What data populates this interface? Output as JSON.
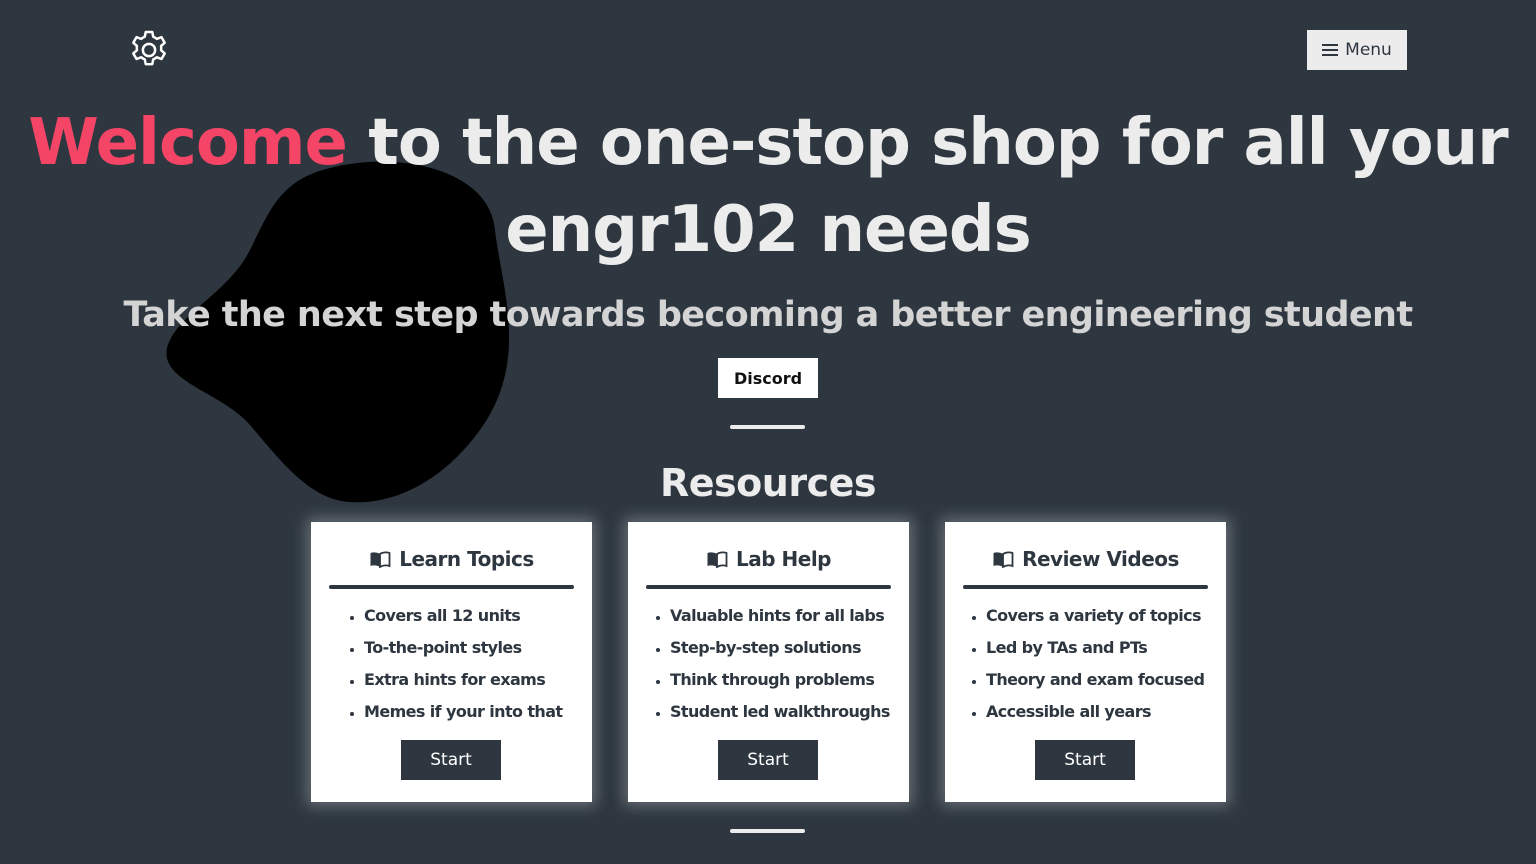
{
  "header": {
    "settings_icon": "gear-icon",
    "menu_icon": "hamburger-icon",
    "menu_label": "Menu"
  },
  "hero": {
    "title_accent": "Welcome",
    "title_rest": " to the one-stop shop for all your engr102 needs",
    "subtitle": "Take the next step towards becoming a better engineering student",
    "discord_label": "Discord"
  },
  "resources": {
    "heading": "Resources",
    "cards": [
      {
        "icon": "open-book-icon",
        "title": "Learn Topics",
        "items": [
          "Covers all 12 units",
          "To-the-point styles",
          "Extra hints for exams",
          "Memes if your into that"
        ],
        "button": "Start"
      },
      {
        "icon": "open-book-icon",
        "title": "Lab Help",
        "items": [
          "Valuable hints for all labs",
          "Step-by-step solutions",
          "Think through problems",
          "Student led walkthroughs"
        ],
        "button": "Start"
      },
      {
        "icon": "open-book-icon",
        "title": "Review Videos",
        "items": [
          "Covers a variety of topics",
          "Led by TAs and PTs",
          "Theory and exam focused",
          "Accessible all years"
        ],
        "button": "Start"
      }
    ]
  },
  "colors": {
    "background": "#2e3740",
    "accent": "#f54567",
    "text_light": "#ececec",
    "card_bg": "#ffffff"
  }
}
